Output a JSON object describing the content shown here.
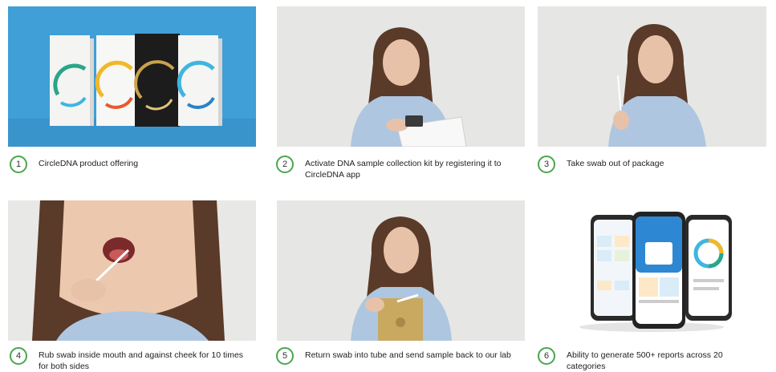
{
  "colors": {
    "accent_green": "#4aa64d",
    "blue_bg": "#3f9fd6",
    "grey_bg": "#e6e6e4"
  },
  "steps": [
    {
      "number": "1",
      "caption": "CircleDNA product offering"
    },
    {
      "number": "2",
      "caption": "Activate DNA sample collection kit by registering it to CircleDNA app"
    },
    {
      "number": "3",
      "caption": "Take swab out of package"
    },
    {
      "number": "4",
      "caption": "Rub swab inside mouth and against cheek for 10 times for both sides"
    },
    {
      "number": "5",
      "caption": "Return swab into tube and send sample back to our lab"
    },
    {
      "number": "6",
      "caption": "Ability to generate 500+ reports across 20 categories"
    }
  ],
  "images": [
    {
      "icon": "product-boxes-image"
    },
    {
      "icon": "woman-with-kit-image"
    },
    {
      "icon": "woman-holding-swab-image"
    },
    {
      "icon": "mouth-swab-image"
    },
    {
      "icon": "woman-with-envelope-image"
    },
    {
      "icon": "app-phones-image"
    }
  ]
}
